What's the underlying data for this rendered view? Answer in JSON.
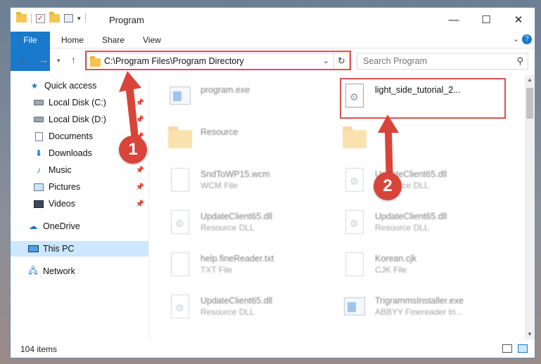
{
  "window": {
    "title": "Program"
  },
  "ribbon": {
    "tabs": [
      "File",
      "Home",
      "Share",
      "View"
    ]
  },
  "address": {
    "path": "C:\\Program Files\\Program Directory"
  },
  "search": {
    "placeholder": "Search Program"
  },
  "sidebar": {
    "items": [
      {
        "label": "Quick access",
        "icon": "star-icon"
      },
      {
        "label": "Local Disk (C:)",
        "icon": "drive-icon",
        "pinned": true
      },
      {
        "label": "Local Disk (D:)",
        "icon": "drive-icon",
        "pinned": true
      },
      {
        "label": "Documents",
        "icon": "document-icon",
        "pinned": true
      },
      {
        "label": "Downloads",
        "icon": "download-icon",
        "pinned": true
      },
      {
        "label": "Music",
        "icon": "music-icon",
        "pinned": true
      },
      {
        "label": "Pictures",
        "icon": "pictures-icon",
        "pinned": true
      },
      {
        "label": "Videos",
        "icon": "videos-icon",
        "pinned": true
      },
      {
        "label": "OneDrive",
        "icon": "cloud-icon"
      },
      {
        "label": "This PC",
        "icon": "computer-icon",
        "selected": true
      },
      {
        "label": "Network",
        "icon": "network-icon"
      }
    ]
  },
  "files": [
    {
      "name": "program.exe",
      "type": "",
      "icon": "exe-icon"
    },
    {
      "name": "light_side_tutorial_2...",
      "type": "",
      "icon": "dll-icon"
    },
    {
      "name": "Resource",
      "type": "",
      "icon": "folder-icon"
    },
    {
      "name": "",
      "type": "",
      "icon": "folder-icon"
    },
    {
      "name": "SndToWP15.wcm",
      "type": "WCM File",
      "icon": "file-icon"
    },
    {
      "name": "UpdateClient65.dll",
      "type": "Resource DLL",
      "icon": "dll-icon"
    },
    {
      "name": "UpdateClient65.dll",
      "type": "Resource DLL",
      "icon": "dll-icon"
    },
    {
      "name": "UpdateClient65.dll",
      "type": "Resource DLL",
      "icon": "dll-icon"
    },
    {
      "name": "help.fineReader.txt",
      "type": "TXT File",
      "icon": "file-icon"
    },
    {
      "name": "Korean.cjk",
      "type": "CJK File",
      "icon": "file-icon"
    },
    {
      "name": "UpdateClient65.dll",
      "type": "Resource DLL",
      "icon": "dll-icon"
    },
    {
      "name": "TrigrammsInstaller.exe",
      "type": "ABBYY Finereader tri...",
      "icon": "installer-icon"
    }
  ],
  "status": {
    "item_count": "104 items"
  },
  "annotations": {
    "step1": "1",
    "step2": "2",
    "color": "#d9443a"
  }
}
